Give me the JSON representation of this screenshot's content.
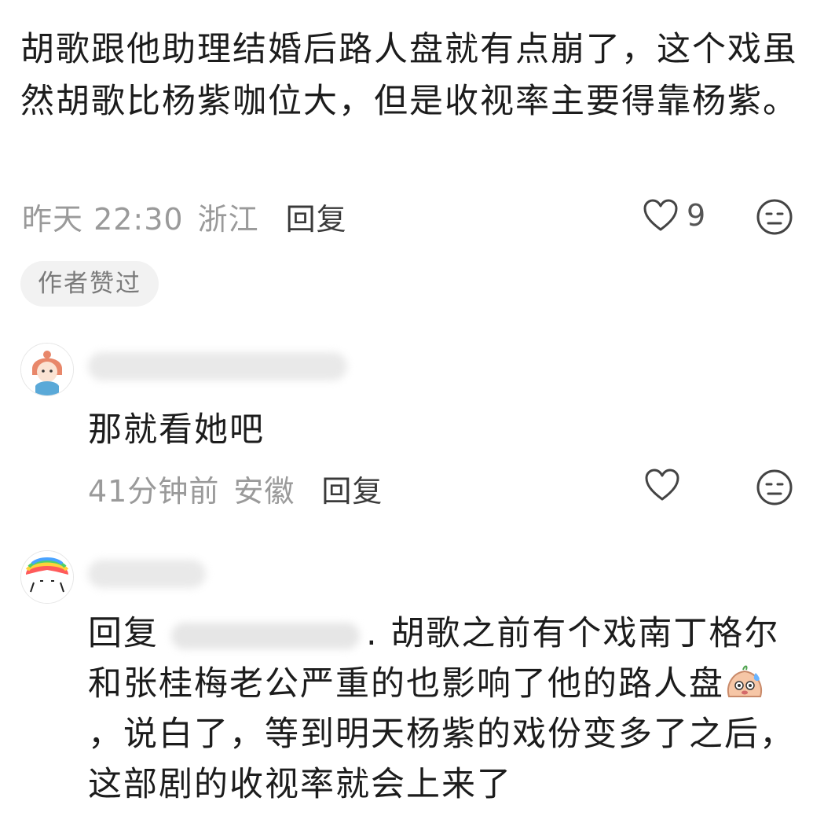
{
  "main_comment": {
    "text": "胡歌跟他助理结婚后路人盘就有点崩了，这个戏虽然胡歌比杨紫咖位大，但是收视率主要得靠杨紫。",
    "time": "昨天 22:30",
    "location": "浙江",
    "reply_label": "回复",
    "like_count": "9",
    "badge": "作者赞过"
  },
  "reply1": {
    "text": "那就看她吧",
    "time": "41分钟前",
    "location": "安徽",
    "reply_label": "回复"
  },
  "reply2": {
    "prefix": "回复",
    "text_part1": ". 胡歌之前有个戏南丁格尔和张桂梅老公严重的也影响了他的路人盘",
    "text_part2": "，说白了，等到明天杨紫的戏份变多了之后，这部剧的收视率就会上来了"
  },
  "icons": {
    "heart": "heart-outline-icon",
    "reaction": "meh-face-icon"
  },
  "colors": {
    "text": "#1c1c1c",
    "meta": "#9a9a9a",
    "badge_bg": "#f2f2f2"
  }
}
